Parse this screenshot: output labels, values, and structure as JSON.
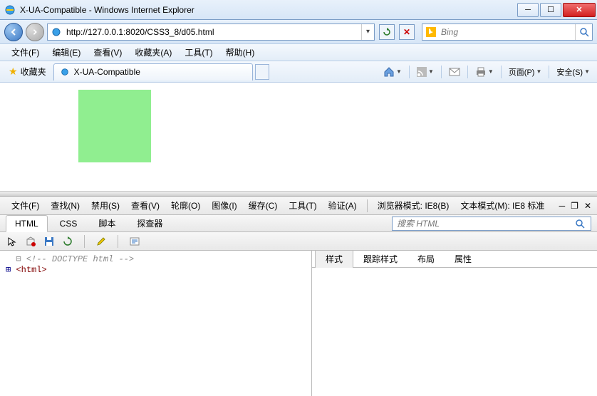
{
  "window": {
    "title": "X-UA-Compatible - Windows Internet Explorer"
  },
  "nav": {
    "url": "http://127.0.0.1:8020/CSS3_8/d05.html",
    "search_placeholder": "Bing"
  },
  "menubar": {
    "items": [
      "文件(F)",
      "编辑(E)",
      "查看(V)",
      "收藏夹(A)",
      "工具(T)",
      "帮助(H)"
    ]
  },
  "favbar": {
    "favorites_label": "收藏夹",
    "tab_title": "X-UA-Compatible",
    "page_label": "页面(P)",
    "safety_label": "安全(S)"
  },
  "content": {
    "box_color": "#90ee90"
  },
  "devtools": {
    "menu": [
      "文件(F)",
      "查找(N)",
      "禁用(S)",
      "查看(V)",
      "轮廓(O)",
      "图像(I)",
      "缓存(C)",
      "工具(T)",
      "验证(A)"
    ],
    "browser_mode": "浏览器模式: IE8(B)",
    "doc_mode": "文本模式(M): IE8 标准",
    "tabs": [
      "HTML",
      "CSS",
      "脚本",
      "探查器"
    ],
    "active_tab": "HTML",
    "search_placeholder": "搜索 HTML",
    "right_tabs": [
      "样式",
      "跟踪样式",
      "布局",
      "属性"
    ],
    "active_right_tab": "样式",
    "tree": {
      "comment": "<!-- DOCTYPE html -->",
      "root": "<html>"
    }
  }
}
